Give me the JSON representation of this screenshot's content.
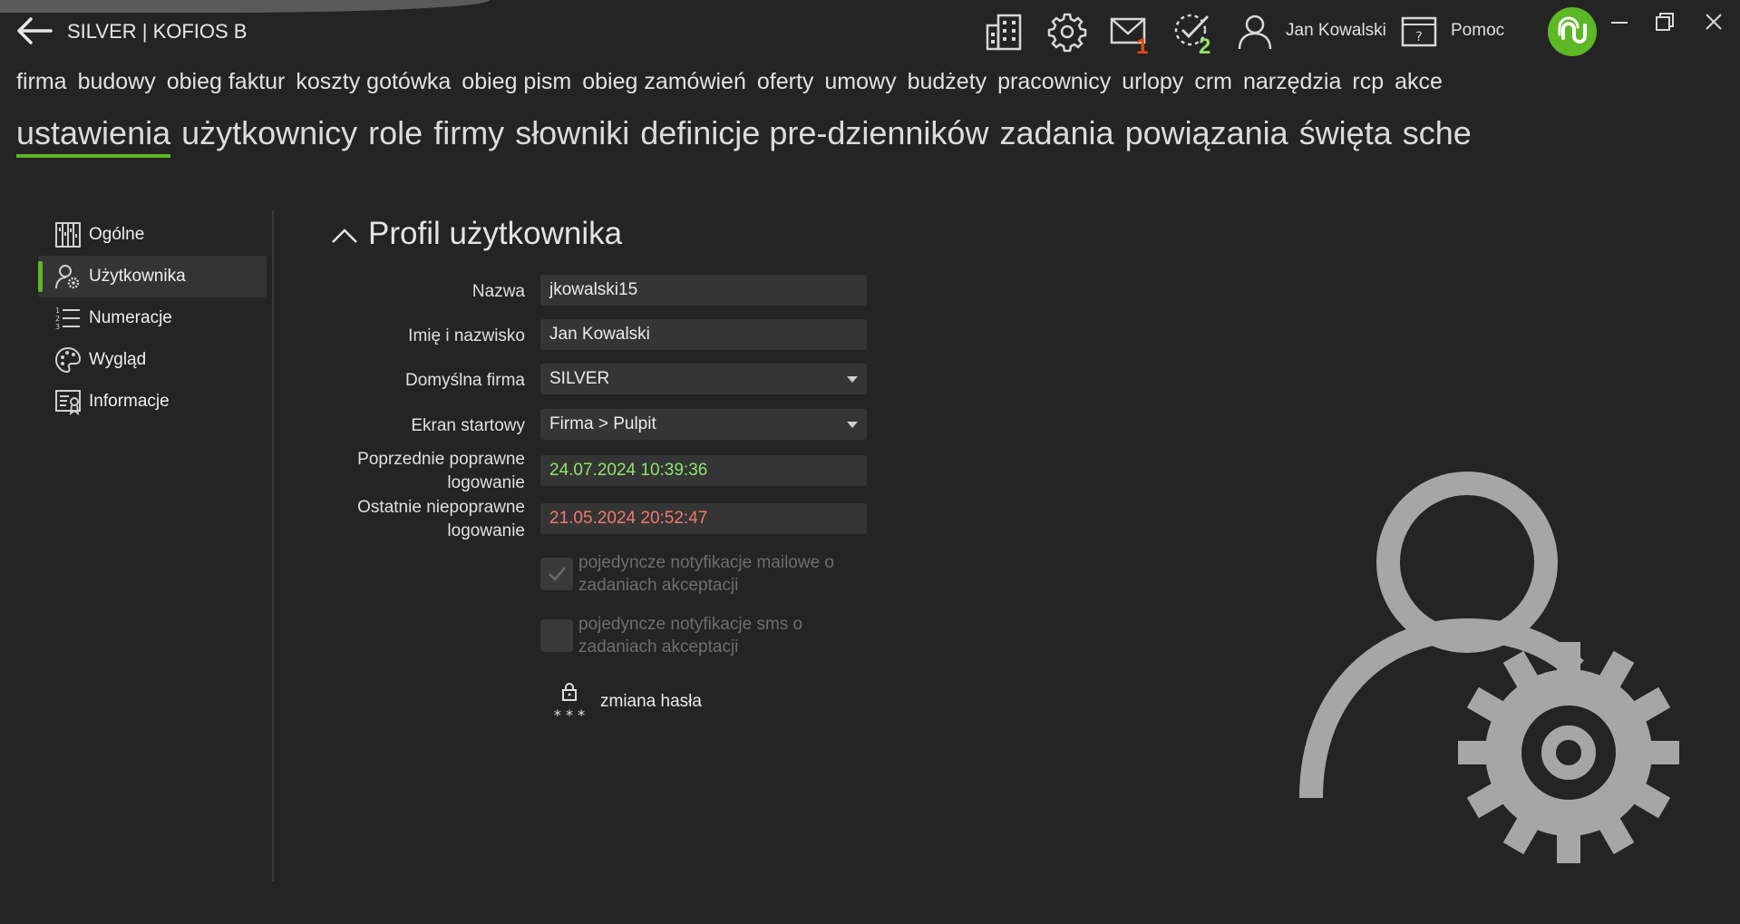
{
  "header": {
    "back_icon": "arrow-left-icon",
    "title": "SILVER | KOFIOS B",
    "messages_badge": "1",
    "tasks_badge": "2",
    "user_name": "Jan Kowalski",
    "help_label": "Pomoc",
    "colors": {
      "accent": "#5cb825",
      "badge_red": "#e84a1a",
      "badge_green": "#8ee56a"
    }
  },
  "menu_primary": [
    "firma",
    "budowy",
    "obieg faktur",
    "koszty gotówka",
    "obieg pism",
    "obieg zamówień",
    "oferty",
    "umowy",
    "budżety",
    "pracownicy",
    "urlopy",
    "crm",
    "narzędzia",
    "rcp",
    "akce"
  ],
  "menu_secondary": [
    "ustawienia",
    "użytkownicy",
    "role",
    "firmy",
    "słowniki",
    "definicje pre-dzienników",
    "zadania",
    "powiązania",
    "święta",
    "schematy a"
  ],
  "sidebar": {
    "items": [
      {
        "label": "Ogólne",
        "icon": "columns-icon"
      },
      {
        "label": "Użytkownika",
        "icon": "user-gear-icon"
      },
      {
        "label": "Numeracje",
        "icon": "numbered-list-icon"
      },
      {
        "label": "Wygląd",
        "icon": "palette-icon"
      },
      {
        "label": "Informacje",
        "icon": "info-card-icon"
      }
    ]
  },
  "profile": {
    "title": "Profil użytkownika",
    "fields": {
      "login_label": "Nazwa",
      "login_value": "jkowalski15",
      "fullname_label": "Imię i nazwisko",
      "fullname_value": "Jan Kowalski",
      "company_label": "Domyślna firma",
      "company_value": "SILVER",
      "start_label": "Ekran startowy",
      "start_value": "Firma > Pulpit",
      "prev_ok_label_1": "Poprzednie poprawne",
      "prev_ok_label_2": "logowanie",
      "prev_ok_value": "24.07.2024 10:39:36",
      "last_bad_label_1": "Ostatnie niepoprawne",
      "last_bad_label_2": "logowanie",
      "last_bad_value": "21.05.2024 20:52:47"
    },
    "checkbox_mail_1": "pojedyncze notyfikacje mailowe o",
    "checkbox_mail_2": "zadaniach akceptacji",
    "checkbox_sms_1": "pojedyncze notyfikacje sms o",
    "checkbox_sms_2": "zadaniach akceptacji",
    "change_password": "zmiana hasła"
  }
}
